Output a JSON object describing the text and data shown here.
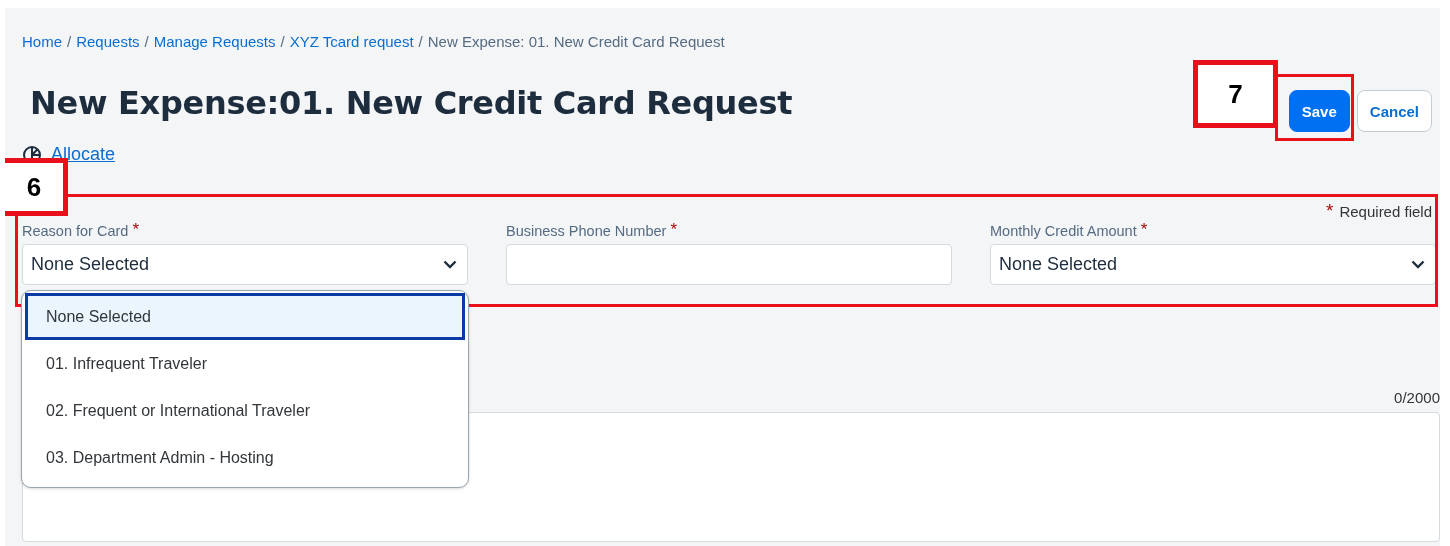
{
  "breadcrumb": [
    {
      "label": "Home",
      "link": true
    },
    {
      "label": "Requests",
      "link": true
    },
    {
      "label": "Manage Requests",
      "link": true
    },
    {
      "label": "XYZ Tcard request",
      "link": true
    },
    {
      "label": "New Expense: 01. New Credit Card Request",
      "link": false
    }
  ],
  "breadcrumb_separator": "/",
  "title": "New Expense:01. New Credit Card Request",
  "actions": [
    {
      "label": "Save",
      "kind": "primary"
    },
    {
      "label": "Cancel",
      "kind": "secondary"
    }
  ],
  "allocate": "Allocate",
  "required_mark": "*",
  "required_note": "Required field",
  "fields": [
    {
      "label": "Reason for Card",
      "required": true,
      "kind": "select",
      "value": "None Selected",
      "expanded": true
    },
    {
      "label": "Business Phone Number",
      "required": true,
      "kind": "text"
    },
    {
      "label": "Monthly Credit Amount",
      "required": true,
      "kind": "select",
      "value": "None Selected"
    }
  ],
  "dropdown_options": [
    {
      "label": "None Selected",
      "selected": true
    },
    {
      "label": "01. Infrequent Traveler",
      "selected": false
    },
    {
      "label": "02. Frequent or International Traveler",
      "selected": false
    },
    {
      "label": "03. Department Admin - Hosting",
      "selected": false
    }
  ],
  "comment": {
    "counter": "0/2000"
  },
  "fields_callout": "6",
  "save_callout": "7"
}
